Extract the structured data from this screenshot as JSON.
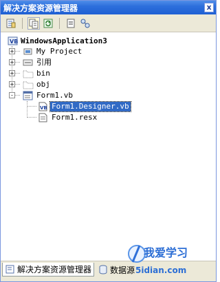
{
  "window": {
    "title": "解决方案资源管理器",
    "close_glyph": "x"
  },
  "toolbar": {
    "buttons": [
      {
        "icon": "properties-icon"
      },
      {
        "icon": "show-all-files-icon",
        "pressed": true
      },
      {
        "icon": "refresh-icon"
      },
      {
        "icon": "view-code-icon"
      },
      {
        "icon": "class-diagram-icon"
      }
    ]
  },
  "tree": {
    "root": {
      "label": "WindowsApplication3",
      "icon": "vb-project-icon"
    },
    "items": [
      {
        "label": "My Project",
        "icon": "my-project-icon",
        "expander": "+"
      },
      {
        "label": "引用",
        "icon": "references-icon",
        "expander": "+"
      },
      {
        "label": "bin",
        "icon": "folder-icon",
        "expander": "+"
      },
      {
        "label": "obj",
        "icon": "folder-icon",
        "expander": "+"
      },
      {
        "label": "Form1.vb",
        "icon": "form-icon",
        "expander": "-"
      }
    ],
    "children": [
      {
        "label": "Form1.Designer.vb",
        "icon": "vb-file-icon",
        "selected": true
      },
      {
        "label": "Form1.resx",
        "icon": "resx-file-icon",
        "selected": false
      }
    ]
  },
  "bottom_tabs": [
    {
      "label": "解决方案资源管理器",
      "active": true
    },
    {
      "label": "数据源",
      "active": false
    }
  ],
  "watermark": {
    "text": "我爱学习",
    "url": "5idian.com"
  }
}
